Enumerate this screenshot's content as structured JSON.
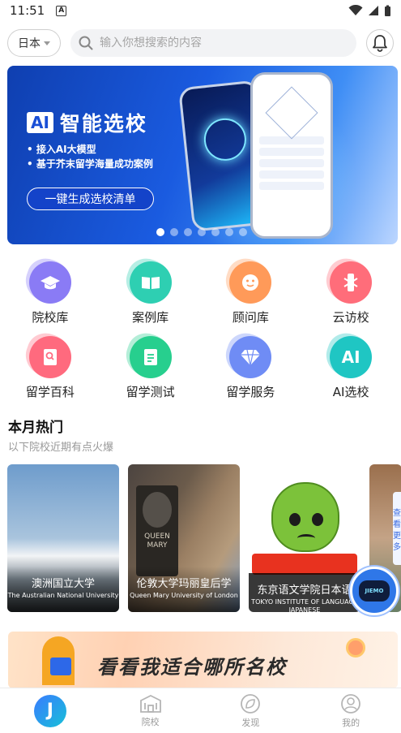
{
  "status_bar": {
    "time": "11:51",
    "a_icon": "A"
  },
  "search": {
    "country": "日本",
    "placeholder": "输入你想搜索的内容"
  },
  "banner": {
    "ai_badge": "AI",
    "title": "智能选校",
    "bullets": [
      "接入AI大模型",
      "基于芥末留学海量成功案例"
    ],
    "cta": "一键生成选校清单",
    "dots_total": 7,
    "dots_active_index": 0
  },
  "categories": [
    {
      "label": "院校库",
      "icon": "graduation-cap-icon",
      "color": "#8a7cf5"
    },
    {
      "label": "案例库",
      "icon": "book-icon",
      "color": "#2ecfb3"
    },
    {
      "label": "顾问库",
      "icon": "advisor-face-icon",
      "color": "#ff9a5a"
    },
    {
      "label": "云访校",
      "icon": "cloud-visit-icon",
      "color": "#ff6d7a"
    },
    {
      "label": "留学百科",
      "icon": "encyclopedia-icon",
      "color": "#ff6b7f"
    },
    {
      "label": "留学测试",
      "icon": "test-document-icon",
      "color": "#27cf8e"
    },
    {
      "label": "留学服务",
      "icon": "diamond-icon",
      "color": "#6f8cf5"
    },
    {
      "label": "AI选校",
      "icon": "ai-icon",
      "color": "#1fc6c4",
      "icon_text": "AI"
    }
  ],
  "hot_section": {
    "title": "本月热门",
    "subtitle": "以下院校近期有点火爆"
  },
  "cards": [
    {
      "cn": "澳洲国立大学",
      "en": "The Australian National University"
    },
    {
      "cn": "伦敦大学玛丽皇后学",
      "en": "Queen Mary University of London",
      "plaque_text": "QUEEN MARY"
    },
    {
      "cn": "东京语文学院日本语",
      "en": "TOKYO INSTITUTE OF LANGUAGE JAPANESE"
    }
  ],
  "side_tab": {
    "text": "查看更多"
  },
  "robot": {
    "label": "JIEMO"
  },
  "promo": {
    "text": "看看我适合哪所名校"
  },
  "bottom_nav": [
    {
      "label": "",
      "icon": "home-logo-icon",
      "logo_text": "J"
    },
    {
      "label": "院校",
      "icon": "school-building-icon"
    },
    {
      "label": "发现",
      "icon": "compass-leaf-icon"
    },
    {
      "label": "我的",
      "icon": "user-profile-icon"
    }
  ],
  "colors": {
    "accent": "#1a5be0",
    "banner_cta": "#1443c9"
  }
}
